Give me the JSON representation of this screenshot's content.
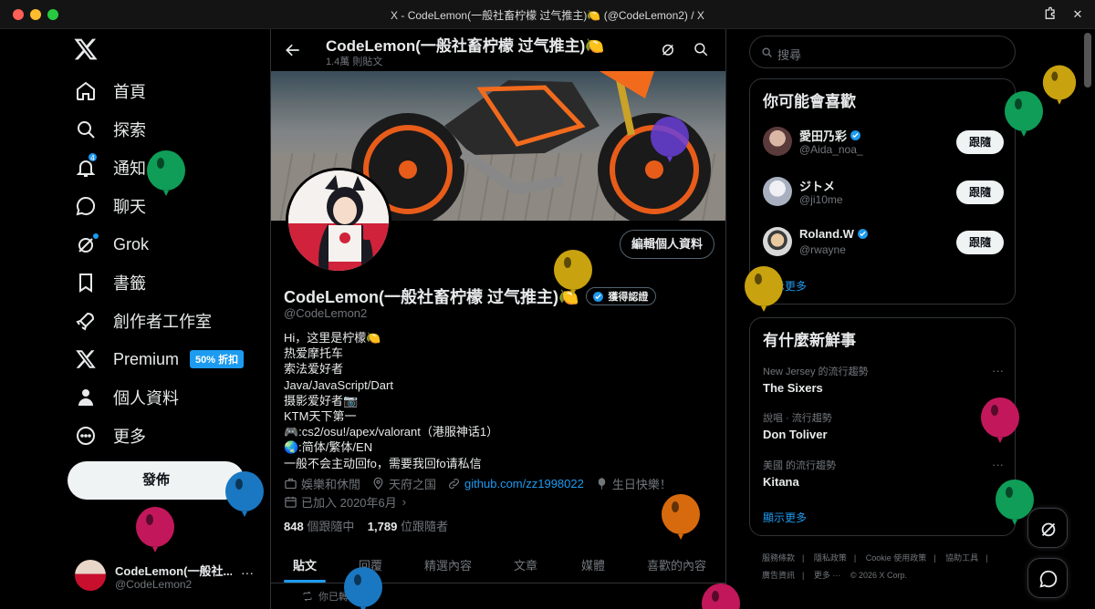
{
  "window": {
    "title": "X - CodeLemon(一般社畜柠檬 过气推主)🍋 (@CodeLemon2) / X"
  },
  "nav": {
    "items": [
      {
        "label": "首頁"
      },
      {
        "label": "探索"
      },
      {
        "label": "通知",
        "badge": "4"
      },
      {
        "label": "聊天"
      },
      {
        "label": "Grok"
      },
      {
        "label": "書籤"
      },
      {
        "label": "創作者工作室"
      },
      {
        "label": "Premium",
        "promo": "50% 折扣"
      },
      {
        "label": "個人資料"
      },
      {
        "label": "更多"
      }
    ],
    "post_label": "發佈",
    "me": {
      "name": "CodeLemon(一般社...",
      "handle": "@CodeLemon2",
      "more": "···"
    }
  },
  "header": {
    "title": "CodeLemon(一般社畜柠檬 过气推主)🍋",
    "subtitle": "1.4萬 則貼文"
  },
  "profile": {
    "edit_label": "編輯個人資料",
    "name": "CodeLemon(一般社畜柠檬 过气推主)🍋",
    "verify_label": "獲得認證",
    "handle": "@CodeLemon2",
    "bio": [
      "Hi，这里是柠檬🍋",
      "热爱摩托车",
      "索法爱好者",
      "Java/JavaScript/Dart",
      "摄影爱好者📷",
      "KTM天下第一",
      "🎮:cs2/osu!/apex/valorant（港服神话1）",
      "🌏:简体/繁体/EN",
      "一般不会主动回fo，需要我回fo请私信"
    ],
    "meta": {
      "category": "娛樂和休閒",
      "location": "天府之国",
      "link": "github.com/zz1998022",
      "birthday": "生日快樂！",
      "joined": "已加入 2020年6月"
    },
    "following_count": "848",
    "following_label": "個跟隨中",
    "followers_count": "1,789",
    "followers_label": "位跟隨者"
  },
  "tabs": [
    "貼文",
    "回覆",
    "精選內容",
    "文章",
    "媒體",
    "喜歡的內容"
  ],
  "feed": {
    "repost_label": "你已轉發"
  },
  "search": {
    "placeholder": "搜尋"
  },
  "who_to_follow": {
    "title": "你可能會喜歡",
    "users": [
      {
        "name": "愛田乃彩",
        "handle": "@Aida_noa_",
        "verified": true,
        "follow_label": "跟隨"
      },
      {
        "name": "ジトメ",
        "handle": "@ji10me",
        "verified": false,
        "follow_label": "跟隨"
      },
      {
        "name": "Roland.W",
        "handle": "@rwayne",
        "verified": true,
        "follow_label": "跟隨"
      }
    ],
    "show_more": "顯示更多"
  },
  "trends": {
    "title": "有什麼新鮮事",
    "items": [
      {
        "context": "New Jersey 的流行趨勢",
        "name": "The Sixers"
      },
      {
        "context": "說唱 · 流行趨勢",
        "name": "Don Toliver"
      },
      {
        "context": "美國 的流行趨勢",
        "name": "Kitana"
      }
    ],
    "show_more": "顯示更多"
  },
  "footer": [
    "服務條款",
    "|",
    "隱私政策",
    "|",
    "Cookie 使用政策",
    "|",
    "協助工具",
    "|",
    "廣告資訊",
    "|",
    "更多 ···",
    "© 2026 X Corp."
  ],
  "colors": {
    "accent": "#1d9bf0",
    "bg": "#000000",
    "border": "#2f3336",
    "muted": "#71767b"
  }
}
